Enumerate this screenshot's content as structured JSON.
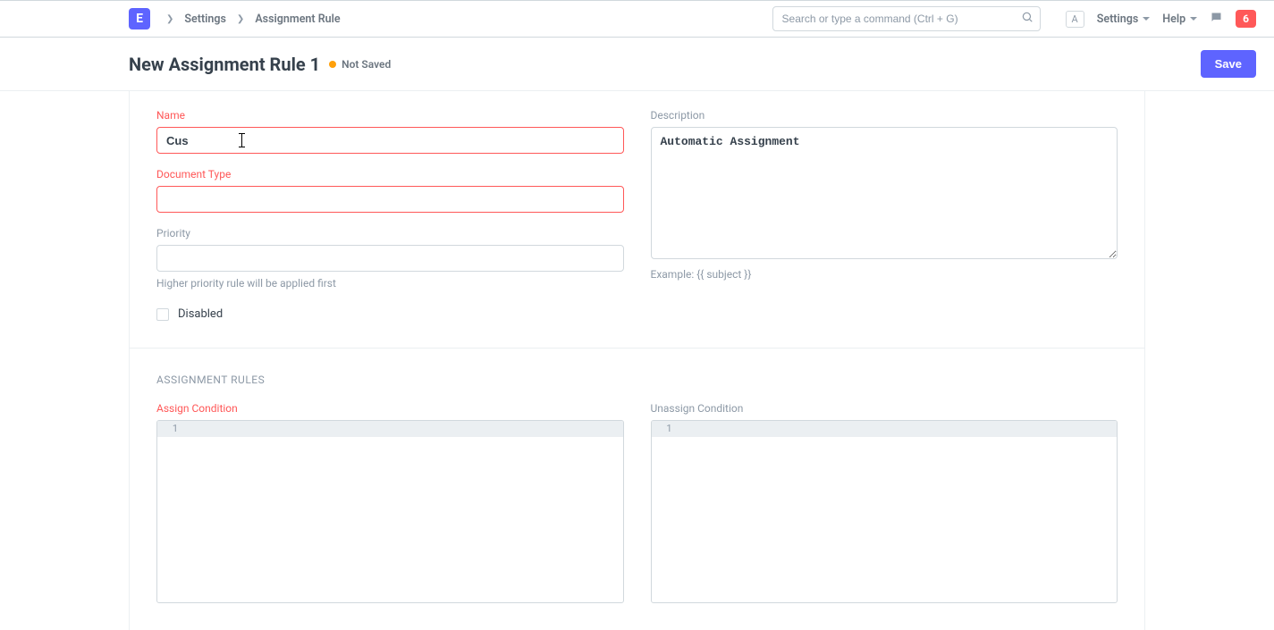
{
  "navbar": {
    "logo": "E",
    "breadcrumbs": [
      "Settings",
      "Assignment Rule"
    ],
    "search_placeholder": "Search or type a command (Ctrl + G)",
    "kbd": "A",
    "settings_label": "Settings",
    "help_label": "Help",
    "notif_count": "6"
  },
  "header": {
    "title": "New Assignment Rule 1",
    "status": "Not Saved",
    "save_label": "Save"
  },
  "form": {
    "name_label": "Name",
    "name_value": "Cus",
    "doctype_label": "Document Type",
    "doctype_value": "",
    "priority_label": "Priority",
    "priority_value": "",
    "priority_help": "Higher priority rule will be applied first",
    "disabled_label": "Disabled",
    "description_label": "Description",
    "description_value": "Automatic Assignment",
    "description_help": "Example: {{ subject }}"
  },
  "rules": {
    "section_title": "ASSIGNMENT RULES",
    "assign_label": "Assign Condition",
    "assign_line": "1",
    "unassign_label": "Unassign Condition",
    "unassign_line": "1"
  }
}
